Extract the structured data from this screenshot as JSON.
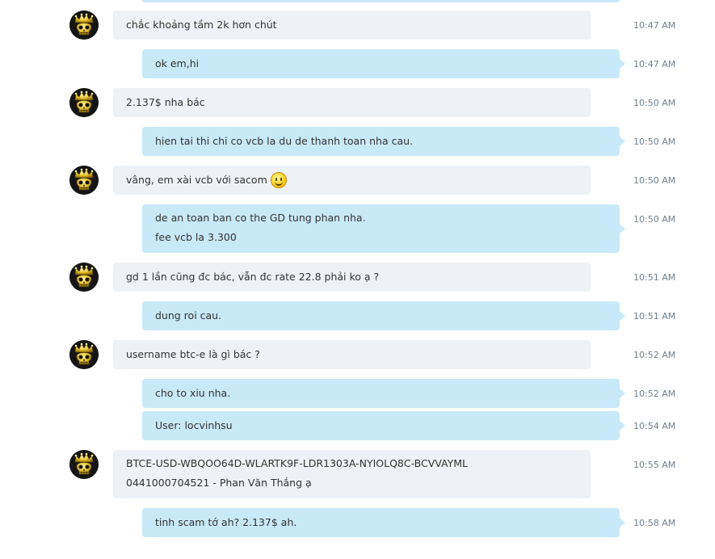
{
  "contact": {
    "avatar_icon": "skull-crown-icon"
  },
  "messages": [
    {
      "direction": "in",
      "lines": [
        "chắc khoảng tầm 2k hơn chút"
      ],
      "time": "10:47 AM"
    },
    {
      "direction": "out",
      "lines": [
        "ok em,hi"
      ],
      "time": "10:47 AM"
    },
    {
      "direction": "in",
      "lines": [
        "2.137$ nha bác"
      ],
      "time": "10:50 AM"
    },
    {
      "direction": "out",
      "lines": [
        "hien tai thi chi co vcb la du de thanh toan nha cau."
      ],
      "time": "10:50 AM"
    },
    {
      "direction": "in",
      "lines": [
        "vâng, em xài vcb với sacom"
      ],
      "emoji": "smile-emoji",
      "time": "10:50 AM"
    },
    {
      "direction": "out",
      "lines": [
        "de an toan ban co the GD tung phan nha.",
        "fee vcb la 3.300"
      ],
      "time": "10:50 AM"
    },
    {
      "direction": "in",
      "lines": [
        "gd 1 lần cũng đc bác, vẫn đc rate 22.8 phải ko ạ ?"
      ],
      "time": "10:51 AM"
    },
    {
      "direction": "out",
      "lines": [
        "dung roi cau."
      ],
      "time": "10:51 AM"
    },
    {
      "direction": "in",
      "lines": [
        "username btc-e là gì bác ?"
      ],
      "time": "10:52 AM"
    },
    {
      "direction": "out",
      "lines": [
        "cho to xiu nha."
      ],
      "time": "10:52 AM"
    },
    {
      "direction": "out",
      "lines": [
        "User: locvinhsu"
      ],
      "time": "10:54 AM"
    },
    {
      "direction": "in",
      "lines": [
        "BTCE-USD-WBQOO64D-WLARTK9F-LDR1303A-NYIOLQ8C-BCVVAYML",
        "0441000704521 - Phan Văn Thắng ạ"
      ],
      "time": "10:55 AM"
    },
    {
      "direction": "out",
      "lines": [
        "tinh scam tớ ah? 2.137$ ah."
      ],
      "time": "10:58 AM"
    }
  ]
}
